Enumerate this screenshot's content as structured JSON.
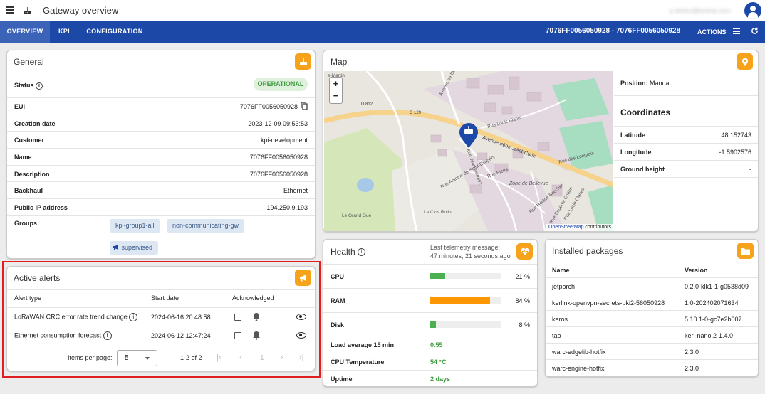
{
  "header": {
    "title": "Gateway overview",
    "user_email": "p.lelriez@kerlink.com"
  },
  "nav": {
    "tabs": [
      "OVERVIEW",
      "KPI",
      "CONFIGURATION"
    ],
    "gateway_eui": "7076FF0056050928 - 7076FF0056050928",
    "actions": "ACTIONS"
  },
  "general": {
    "title": "General",
    "status_label": "Status",
    "status_value": "OPERATIONAL",
    "rows": [
      {
        "label": "EUI",
        "value": "7076FF0056050928"
      },
      {
        "label": "Creation date",
        "value": "2023-12-09 09:53:53"
      },
      {
        "label": "Customer",
        "value": "kpi-development"
      },
      {
        "label": "Name",
        "value": "7076FF0056050928"
      },
      {
        "label": "Description",
        "value": "7076FF0056050928"
      },
      {
        "label": "Backhaul",
        "value": "Ethernet"
      },
      {
        "label": "Public IP address",
        "value": "194.250.9.193"
      }
    ],
    "groups_label": "Groups",
    "groups": [
      "kpi-group1-all",
      "non-communicating-gw",
      "supervised"
    ]
  },
  "alerts": {
    "title": "Active alerts",
    "headers": [
      "Alert type",
      "Start date",
      "Acknowledged"
    ],
    "rows": [
      {
        "type": "LoRaWAN CRC error rate trend change",
        "date": "2024-06-16 20:48:58"
      },
      {
        "type": "Ethernet consumption forecast",
        "date": "2024-06-12 12:47:24"
      }
    ],
    "items_per_page_label": "Items per page:",
    "items_per_page": "5",
    "range": "1-2 of 2",
    "page": "1"
  },
  "map": {
    "title": "Map",
    "position_label": "Position:",
    "position_value": "Manual",
    "coordinates_title": "Coordinates",
    "rows": [
      {
        "label": "Latitude",
        "value": "48.152743"
      },
      {
        "label": "Longitude",
        "value": "-1.5902576"
      },
      {
        "label": "Ground height",
        "value": "-"
      }
    ],
    "attribution_link": "OpenStreetMap",
    "attribution_rest": " contributors",
    "labels": {
      "d812": "D 812",
      "c129": "C 129",
      "avenue_bellevue": "Avenue de Bellevue",
      "rue_blanot": "Rue Louis Blanot",
      "avenue_curie": "Avenue Irène Joliot-Curie",
      "rue_longrais": "Rue des Longrais",
      "rue_boucher": "Rue Hélène Boucher",
      "zone_bellevue": "Zone de\nBellevue",
      "rue_st_exupery": "Rue Antoine de Saint-Exupéry",
      "clos_rolin": "Le Clos Rolin",
      "grand_gue": "Le Grand\nGué",
      "mermoz": "Rue Jean Mermoz",
      "martin": "e-Martin",
      "curie2": "Rue Pierre",
      "cotton": "Rue Eugénie Cotton",
      "clairac": "Rue Lucie Clairac"
    }
  },
  "health": {
    "title": "Health",
    "telemetry_label": "Last telemetry message:",
    "telemetry_value": "47 minutes, 21 seconds ago",
    "bars": [
      {
        "label": "CPU",
        "value": 21,
        "text": "21 %",
        "color": "#4caf50"
      },
      {
        "label": "RAM",
        "value": 84,
        "text": "84 %",
        "color": "#ff9800"
      },
      {
        "label": "Disk",
        "value": 8,
        "text": "8 %",
        "color": "#4caf50"
      }
    ],
    "stats": [
      {
        "label": "Load average 15 min",
        "value": "0.55"
      },
      {
        "label": "CPU Temperature",
        "value": "54 °C"
      },
      {
        "label": "Uptime",
        "value": "2 days"
      }
    ]
  },
  "packages": {
    "title": "Installed packages",
    "headers": [
      "Name",
      "Version"
    ],
    "rows": [
      {
        "name": "jetporch",
        "version": "0.2.0-klk1-1-g0538d09"
      },
      {
        "name": "kerlink-openvpn-secrets-pki2-56050928",
        "version": "1.0-202402071634"
      },
      {
        "name": "keros",
        "version": "5.10.1-0-gc7e2b007"
      },
      {
        "name": "tao",
        "version": "kerl-nano.2-1.4.0"
      },
      {
        "name": "warc-edgelib-hotfix",
        "version": "2.3.0"
      },
      {
        "name": "warc-engine-hotfix",
        "version": "2.3.0"
      }
    ]
  },
  "colors": {
    "primary": "#1c49a8",
    "accent": "#f7a21b",
    "ok": "#3c9a3c"
  }
}
